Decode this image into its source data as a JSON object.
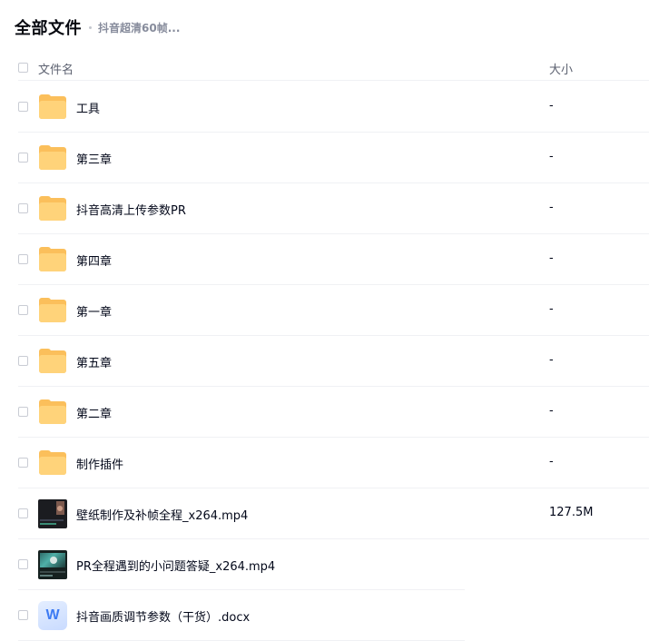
{
  "header": {
    "title": "全部文件",
    "breadcrumb": "抖音超清60帧..."
  },
  "columns": {
    "name": "文件名",
    "size": "大小"
  },
  "files": [
    {
      "name": "工具",
      "size": "-",
      "icon": "folder-icon"
    },
    {
      "name": "第三章",
      "size": "-",
      "icon": "folder-icon"
    },
    {
      "name": "抖音高清上传参数PR",
      "size": "-",
      "icon": "folder-icon"
    },
    {
      "name": "第四章",
      "size": "-",
      "icon": "folder-icon"
    },
    {
      "name": "第一章",
      "size": "-",
      "icon": "folder-icon"
    },
    {
      "name": "第五章",
      "size": "-",
      "icon": "folder-icon"
    },
    {
      "name": "第二章",
      "size": "-",
      "icon": "folder-icon"
    },
    {
      "name": "制作插件",
      "size": "-",
      "icon": "folder-icon"
    },
    {
      "name": "壁纸制作及补帧全程_x264.mp4",
      "size": "127.5M",
      "icon": "video-thumbnail"
    },
    {
      "name": "PR全程遇到的小问题答疑_x264.mp4",
      "size": "",
      "icon": "video-thumbnail"
    },
    {
      "name": "抖音画质调节参数（干货）.docx",
      "size": "",
      "icon": "word-doc-icon",
      "icon_letter": "W"
    }
  ],
  "colors": {
    "folder": "#fbbf5b",
    "word_accent": "#3d7bf3",
    "divider": "#f0f1f4"
  }
}
